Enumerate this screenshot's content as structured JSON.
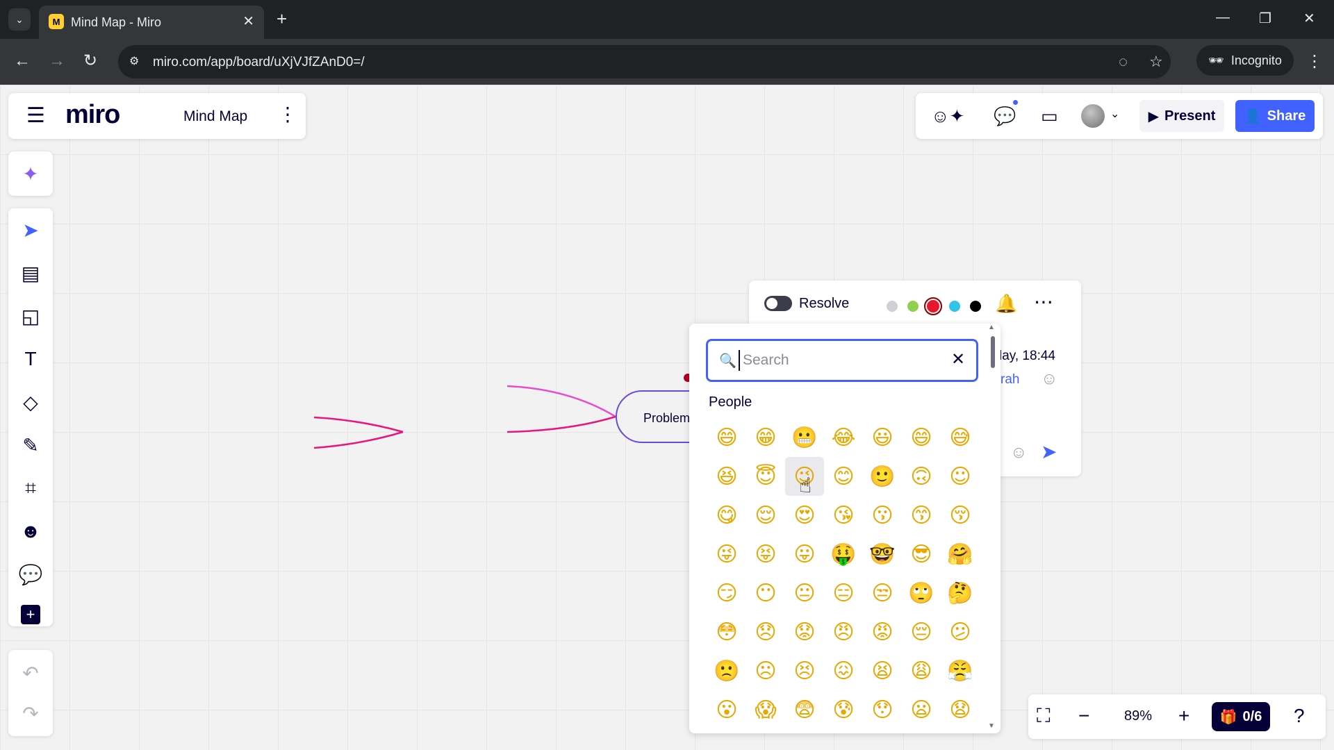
{
  "browser": {
    "tab_title": "Mind Map - Miro",
    "tab_favicon": "M",
    "url": "miro.com/app/board/uXjVJfZAnD0=/",
    "incognito_label": "Incognito"
  },
  "header": {
    "logo": "miro",
    "board_name": "Mind Map",
    "present_label": "Present",
    "share_label": "Share"
  },
  "toolbar": {
    "items": [
      "ai-sparkle",
      "select",
      "templates",
      "sticky-note",
      "text",
      "shapes",
      "pen",
      "frame",
      "stickers",
      "comment",
      "more-apps"
    ],
    "undo": "undo",
    "redo": "redo"
  },
  "zoom": {
    "value": "89%",
    "activity": "0/6"
  },
  "mindmap": {
    "node_label": "Problem"
  },
  "comment": {
    "resolve_label": "Resolve",
    "date_fragment": "lay, 18:44",
    "author_fragment": "rah",
    "colors": [
      "#d0d0d8",
      "#8fd14f",
      "#e6172c",
      "#2ec5e8",
      "#000000"
    ],
    "selected_color": "#e6172c"
  },
  "emoji_picker": {
    "search_placeholder": "Search",
    "search_value": "",
    "section_label": "People",
    "emojis": [
      "😄",
      "😁",
      "😬",
      "😂",
      "😃",
      "😄",
      "😅",
      "😆",
      "😇",
      "😉",
      "😊",
      "🙂",
      "🙃",
      "☺",
      "😋",
      "😌",
      "😍",
      "😘",
      "😗",
      "😙",
      "😚",
      "😜",
      "😝",
      "😛",
      "🤑",
      "🤓",
      "😎",
      "🤗",
      "😏",
      "😶",
      "😐",
      "😑",
      "😒",
      "🙄",
      "🤔",
      "😳",
      "😞",
      "😟",
      "😠",
      "😡",
      "😔",
      "😕",
      "🙁",
      "☹",
      "😣",
      "😖",
      "😫",
      "😩",
      "😤",
      "😮",
      "😱",
      "😨",
      "😰",
      "😯",
      "😦",
      "😧"
    ],
    "hovered_index": 9
  }
}
